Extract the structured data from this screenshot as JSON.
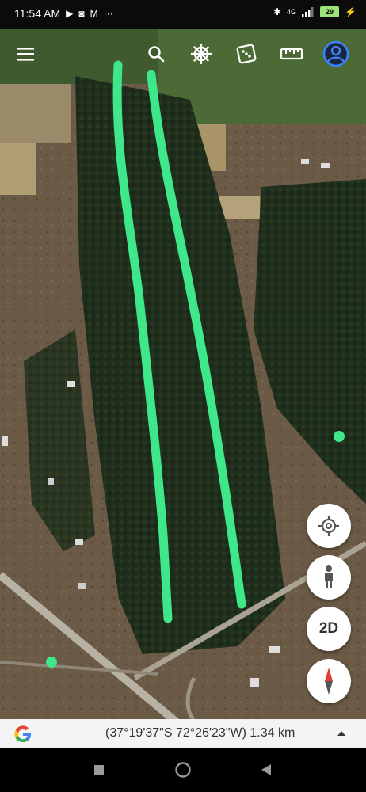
{
  "status_bar": {
    "time": "11:54 AM",
    "network": "4G",
    "battery": "29"
  },
  "toolbar": {
    "menu_icon": "hamburger-menu-icon",
    "search_icon": "search-icon",
    "voyager_icon": "ship-wheel-icon",
    "feeling_lucky_icon": "dice-icon",
    "measure_icon": "ruler-icon",
    "account_icon": "account-icon"
  },
  "map_controls": {
    "my_location_icon": "crosshair-icon",
    "street_view_icon": "pegman-icon",
    "view_mode_label": "2D",
    "compass_icon": "compass-icon"
  },
  "drawing": {
    "stroke_color": "#3ee88a"
  },
  "bottom_bar": {
    "coordinates": "(37°19'37\"S 72°26'23\"W) 1.34 km",
    "expand_icon": "caret-up-icon"
  },
  "nav_bar": {
    "recents_icon": "square-icon",
    "home_icon": "circle-icon",
    "back_icon": "triangle-back-icon"
  }
}
